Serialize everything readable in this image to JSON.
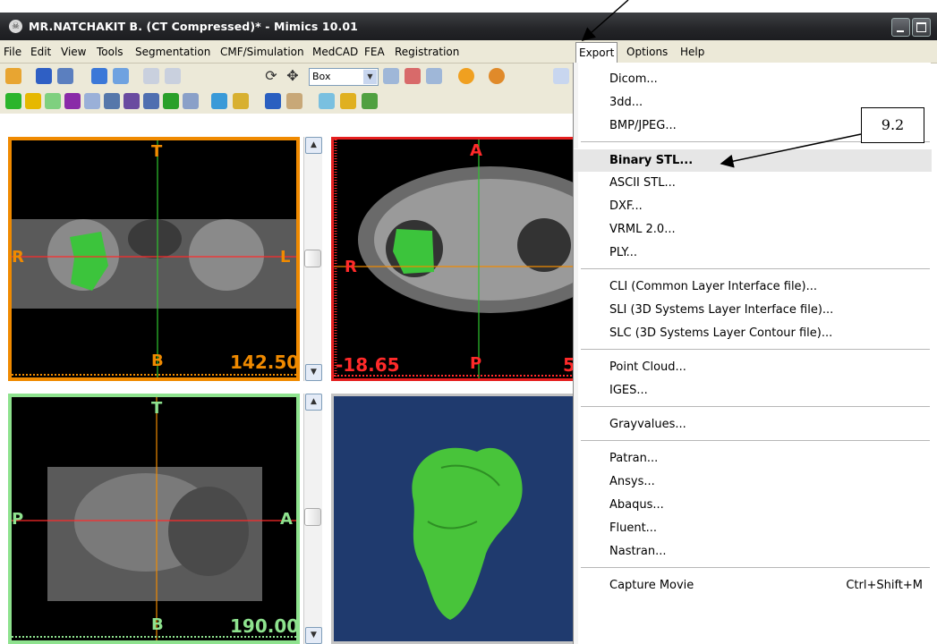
{
  "window": {
    "title": "MR.NATCHAKIT B. (CT Compressed)* - Mimics  10.01",
    "app_icon": "skull-icon",
    "titlebar_color": "#242528"
  },
  "menubar": {
    "items": [
      "File",
      "Edit",
      "View",
      "Tools",
      "Segmentation",
      "CMF/Simulation",
      "MedCAD",
      "FEA",
      "Registration",
      "Export",
      "Options",
      "Help"
    ],
    "active": "Export"
  },
  "toolbar": {
    "zoom_mode": "Box"
  },
  "viewports": {
    "coronal": {
      "top": "T",
      "bottom": "B",
      "left": "R",
      "right": "L",
      "value": "142.50",
      "frame_color": "#f08a00"
    },
    "axial": {
      "top": "A",
      "bottom": "P",
      "left": "R",
      "value_left": "-18.65",
      "value_right": "5",
      "frame_color": "#e51f1f"
    },
    "sagittal": {
      "top": "T",
      "bottom": "B",
      "left": "P",
      "right": "A",
      "value": "190.00",
      "frame_color": "#8ee28e"
    },
    "threed": {
      "background": "#1f3a6e",
      "model_color": "#48c43a"
    }
  },
  "export_menu": {
    "groups": [
      [
        "Dicom...",
        "3dd...",
        "BMP/JPEG..."
      ],
      [
        "Binary STL...",
        "ASCII STL...",
        "DXF...",
        "VRML 2.0...",
        "PLY..."
      ],
      [
        "CLI (Common Layer Interface file)...",
        "SLI (3D Systems Layer Interface file)...",
        "SLC (3D Systems Layer Contour file)..."
      ],
      [
        "Point Cloud...",
        "IGES..."
      ],
      [
        "Grayvalues..."
      ],
      [
        "Patran...",
        "Ansys...",
        "Abaqus...",
        "Fluent...",
        "Nastran..."
      ],
      [
        "Capture Movie"
      ]
    ],
    "highlighted": "Binary STL...",
    "shortcut": {
      "item": "Capture Movie",
      "keys": "Ctrl+Shift+M"
    }
  },
  "callout": {
    "label": "9.2"
  }
}
